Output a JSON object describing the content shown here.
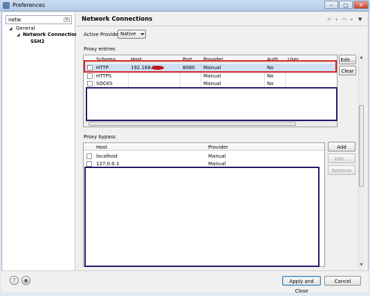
{
  "window": {
    "title": "Preferences",
    "min_icon": "minimize-icon",
    "max_icon": "maximize-icon",
    "close_icon": "close-icon"
  },
  "sidebar": {
    "filter_value": "netw",
    "tree": [
      {
        "label": "General",
        "expanded": true
      },
      {
        "label": "Network Connections",
        "selected": true
      },
      {
        "label": "SSH2"
      }
    ]
  },
  "page": {
    "title": "Network Connections",
    "nav_icons": [
      "back-arrow-icon",
      "forward-arrow-icon",
      "view-menu-icon"
    ]
  },
  "active_provider": {
    "label": "Active Provider:",
    "value": "Native"
  },
  "proxy_entries": {
    "label": "Proxy entries",
    "columns": [
      "Schema",
      "Host",
      "Port",
      "Provider",
      "Auth",
      "User"
    ],
    "rows": [
      {
        "checked": false,
        "schema": "HTTP",
        "host": "192.168.10",
        "port": "8080",
        "provider": "Manual",
        "auth": "No",
        "user": ""
      },
      {
        "checked": false,
        "schema": "HTTPS",
        "host": "",
        "port": "",
        "provider": "Manual",
        "auth": "No",
        "user": ""
      },
      {
        "checked": false,
        "schema": "SOCKS",
        "host": "",
        "port": "",
        "provider": "Manual",
        "auth": "No",
        "user": ""
      }
    ],
    "buttons": {
      "edit": "Edit...",
      "clear": "Clear"
    }
  },
  "proxy_bypass": {
    "label": "Proxy bypass",
    "columns": [
      "Host",
      "Provider"
    ],
    "rows": [
      {
        "checked": false,
        "host": "localhost",
        "provider": "Manual"
      },
      {
        "checked": false,
        "host": "127.0.0.1",
        "provider": "Manual"
      }
    ],
    "buttons": {
      "add": "Add Host...",
      "edit": "Edit...",
      "remove": "Remove"
    }
  },
  "footer": {
    "help_icon": "help-icon",
    "import_icon": "import-export-icon",
    "apply_close": "Apply and Close",
    "cancel": "Cancel"
  },
  "colors": {
    "highlight_border": "#d42222",
    "redaction_border": "#1a1a66",
    "selection_bg": "#cfe0f5"
  }
}
